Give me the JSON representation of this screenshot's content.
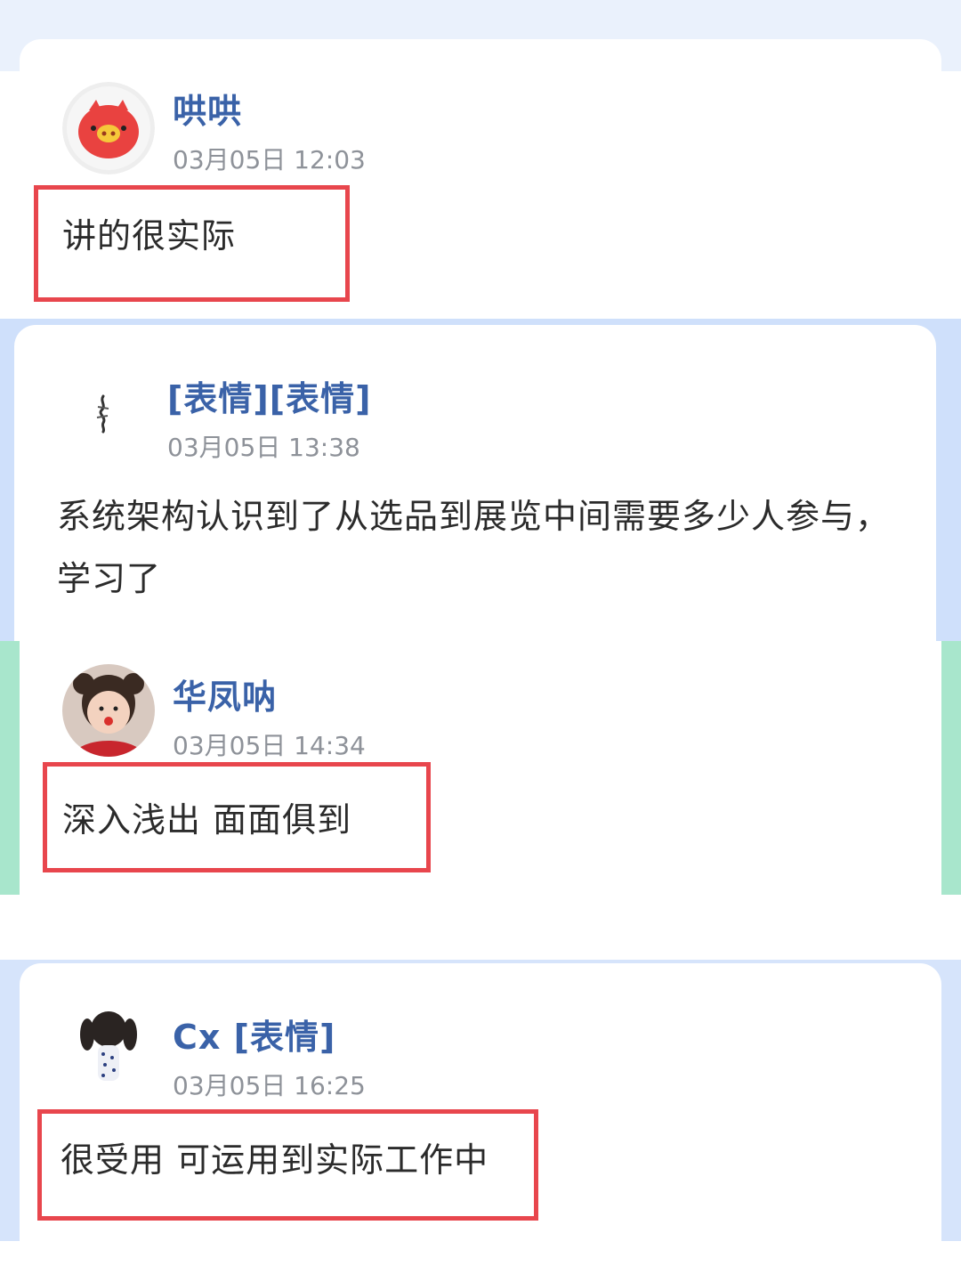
{
  "comments": [
    {
      "avatar": "red-pig-avatar-icon",
      "username": "哄哄",
      "time": "03月05日 12:03",
      "text": "讲的很实际",
      "highlighted": true
    },
    {
      "avatar": "calligraphy-avatar-icon",
      "username": "[表情][表情]",
      "time": "03月05日 13:38",
      "text": "系统架构认识到了从选品到展览中间需要多少人参与，学习了",
      "highlighted": false
    },
    {
      "avatar": "child-photo-avatar-icon",
      "username": "华凤呐",
      "time": "03月05日 14:34",
      "text": "深入浅出 面面俱到",
      "highlighted": true
    },
    {
      "avatar": "girl-cartoon-avatar-icon",
      "username": "Cx [表情]",
      "time": "03月05日 16:25",
      "text": "很受用 可运用到实际工作中",
      "highlighted": true
    }
  ],
  "colors": {
    "username": "#3a62a8",
    "timestamp": "#8e9299",
    "comment_text": "#2b2b2b",
    "highlight_border": "#e8464d",
    "background_blue": "#cfe0fb",
    "background_green": "#a8e6cc"
  }
}
